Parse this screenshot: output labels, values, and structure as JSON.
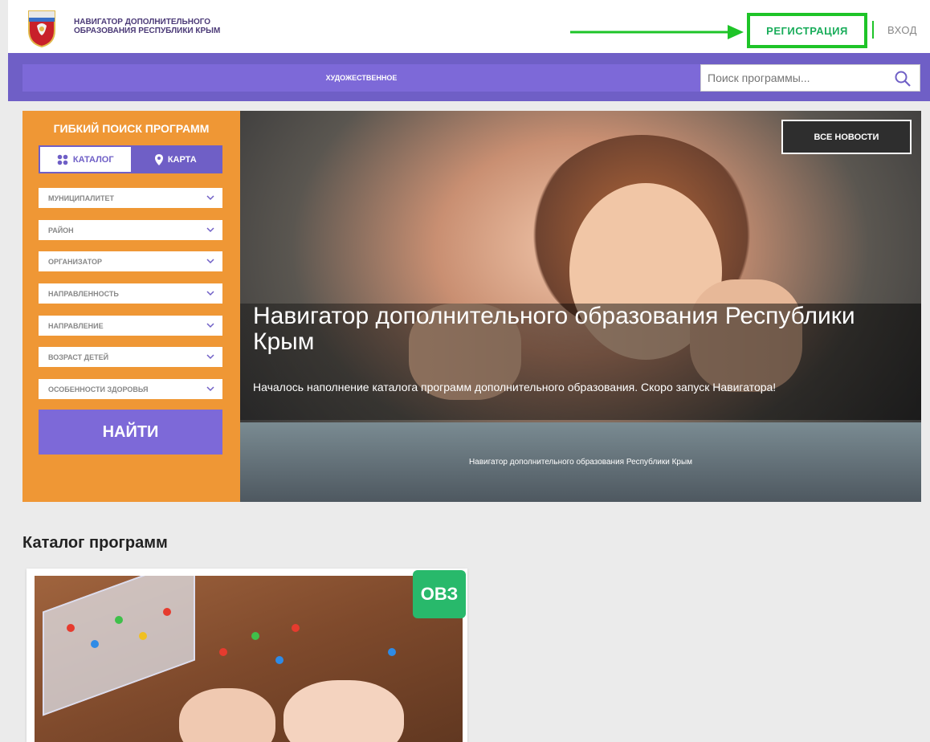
{
  "header": {
    "site_name_line1": "НАВИГАТОР ДОПОЛНИТЕЛЬНОГО",
    "site_name_line2": "ОБРАЗОВАНИЯ РЕСПУБЛИКИ КРЫМ",
    "register_label": "РЕГИСТРАЦИЯ",
    "login_label": "ВХОД"
  },
  "nav": {
    "category": "ХУДОЖЕСТВЕННОЕ",
    "search_placeholder": "Поиск программы..."
  },
  "filter": {
    "title": "ГИБКИЙ ПОИСК ПРОГРАММ",
    "tab_catalog": "КАТАЛОГ",
    "tab_map": "КАРТА",
    "selects": [
      "МУНИЦИПАЛИТЕТ",
      "РАЙОН",
      "ОРГАНИЗАТОР",
      "НАПРАВЛЕННОСТЬ",
      "НАПРАВЛЕНИЕ",
      "ВОЗРАСТ ДЕТЕЙ",
      "ОСОБЕННОСТИ ЗДОРОВЬЯ"
    ],
    "find_label": "НАЙТИ"
  },
  "banner": {
    "all_news": "ВСЕ НОВОСТИ",
    "title": "Навигатор дополнительного образования Республики Крым",
    "subtitle": "Началось наполнение каталога программ дополнительного образования. Скоро запуск Навигатора!",
    "caption": "Навигатор дополнительного образования Республики Крым"
  },
  "catalog": {
    "title": "Каталог программ",
    "badge": "ОВЗ"
  },
  "colors": {
    "purple": "#6f5fc6",
    "orange": "#ef9735",
    "green_highlight": "#1ec428",
    "badge_green": "#28b96b"
  }
}
